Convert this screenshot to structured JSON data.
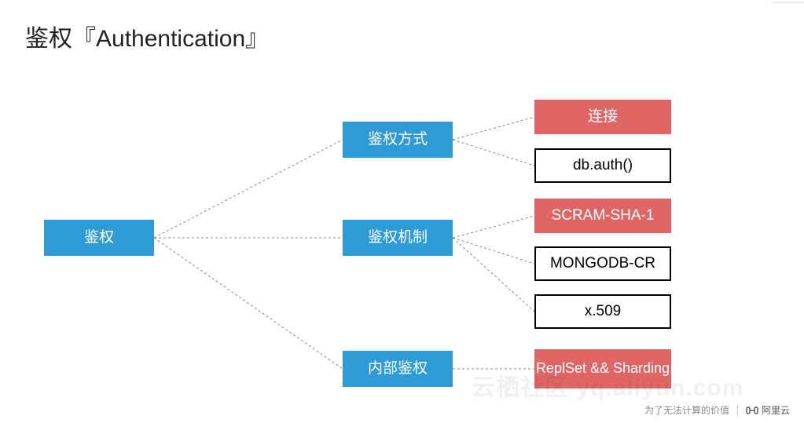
{
  "title": "鉴权『Authentication』",
  "root": {
    "label": "鉴权"
  },
  "branches": {
    "method": {
      "label": "鉴权方式"
    },
    "mechanism": {
      "label": "鉴权机制"
    },
    "internal": {
      "label": "内部鉴权"
    }
  },
  "leaves": {
    "connect": {
      "label": "连接"
    },
    "dbauth": {
      "label": "db.auth()"
    },
    "scram": {
      "label": "SCRAM-SHA-1"
    },
    "mongodbcr": {
      "label": "MONGODB-CR"
    },
    "x509": {
      "label": "x.509"
    },
    "replset": {
      "label": "ReplSet && Sharding"
    }
  },
  "footer": {
    "slogan": "为了无法计算的价值",
    "brand": "阿里云"
  },
  "watermark": "云栖社区  yq.aliyun.com"
}
